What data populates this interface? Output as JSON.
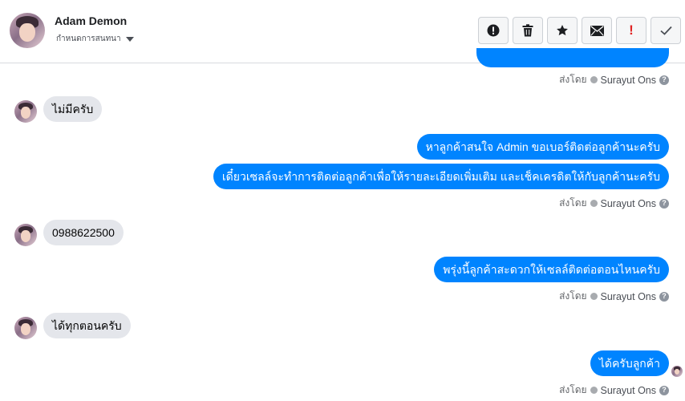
{
  "header": {
    "name": "Adam Demon",
    "subtitle": "กำหนดการสนทนา",
    "avatar_icon": "user-avatar-icon"
  },
  "toolbar": {
    "buttons": [
      {
        "name": "alert-circle-icon",
        "color": "#1c1e21"
      },
      {
        "name": "trash-icon",
        "color": "#1c1e21"
      },
      {
        "name": "star-icon",
        "color": "#1c1e21"
      },
      {
        "name": "envelope-icon",
        "color": "#1c1e21"
      },
      {
        "name": "exclamation-icon",
        "label": "!",
        "color": "#e02424"
      },
      {
        "name": "check-icon",
        "color": "#4b4f56"
      }
    ]
  },
  "conversation": {
    "sent_by_label": "ส่งโดย",
    "sender": "Surayut Ons",
    "info_glyph": "?",
    "messages": [
      {
        "direction": "in",
        "text": "ไม่มีครับ"
      },
      {
        "direction": "out",
        "text": "หาลูกค้าสนใจ Admin ขอเบอร์ติดต่อลูกค้านะครับ"
      },
      {
        "direction": "out",
        "text": "เดี๋ยวเซลล์จะทำการติดต่อลูกค้าเพื่อให้รายละเอียดเพิ่มเติม และเช็คเครดิตให้กับลูกค้านะครับ"
      },
      {
        "direction": "in",
        "text": "0988622500"
      },
      {
        "direction": "out",
        "text": "พรุ่งนี้ลูกค้าสะดวกให้เซลล์ติดต่อตอนไหนครับ"
      },
      {
        "direction": "in",
        "text": "ได้ทุกตอนครับ"
      },
      {
        "direction": "out",
        "text": "ได้ครับลูกค้า"
      }
    ]
  },
  "colors": {
    "outgoing_bubble": "#0084ff",
    "incoming_bubble": "#e4e6eb",
    "alert_red": "#e02424"
  }
}
